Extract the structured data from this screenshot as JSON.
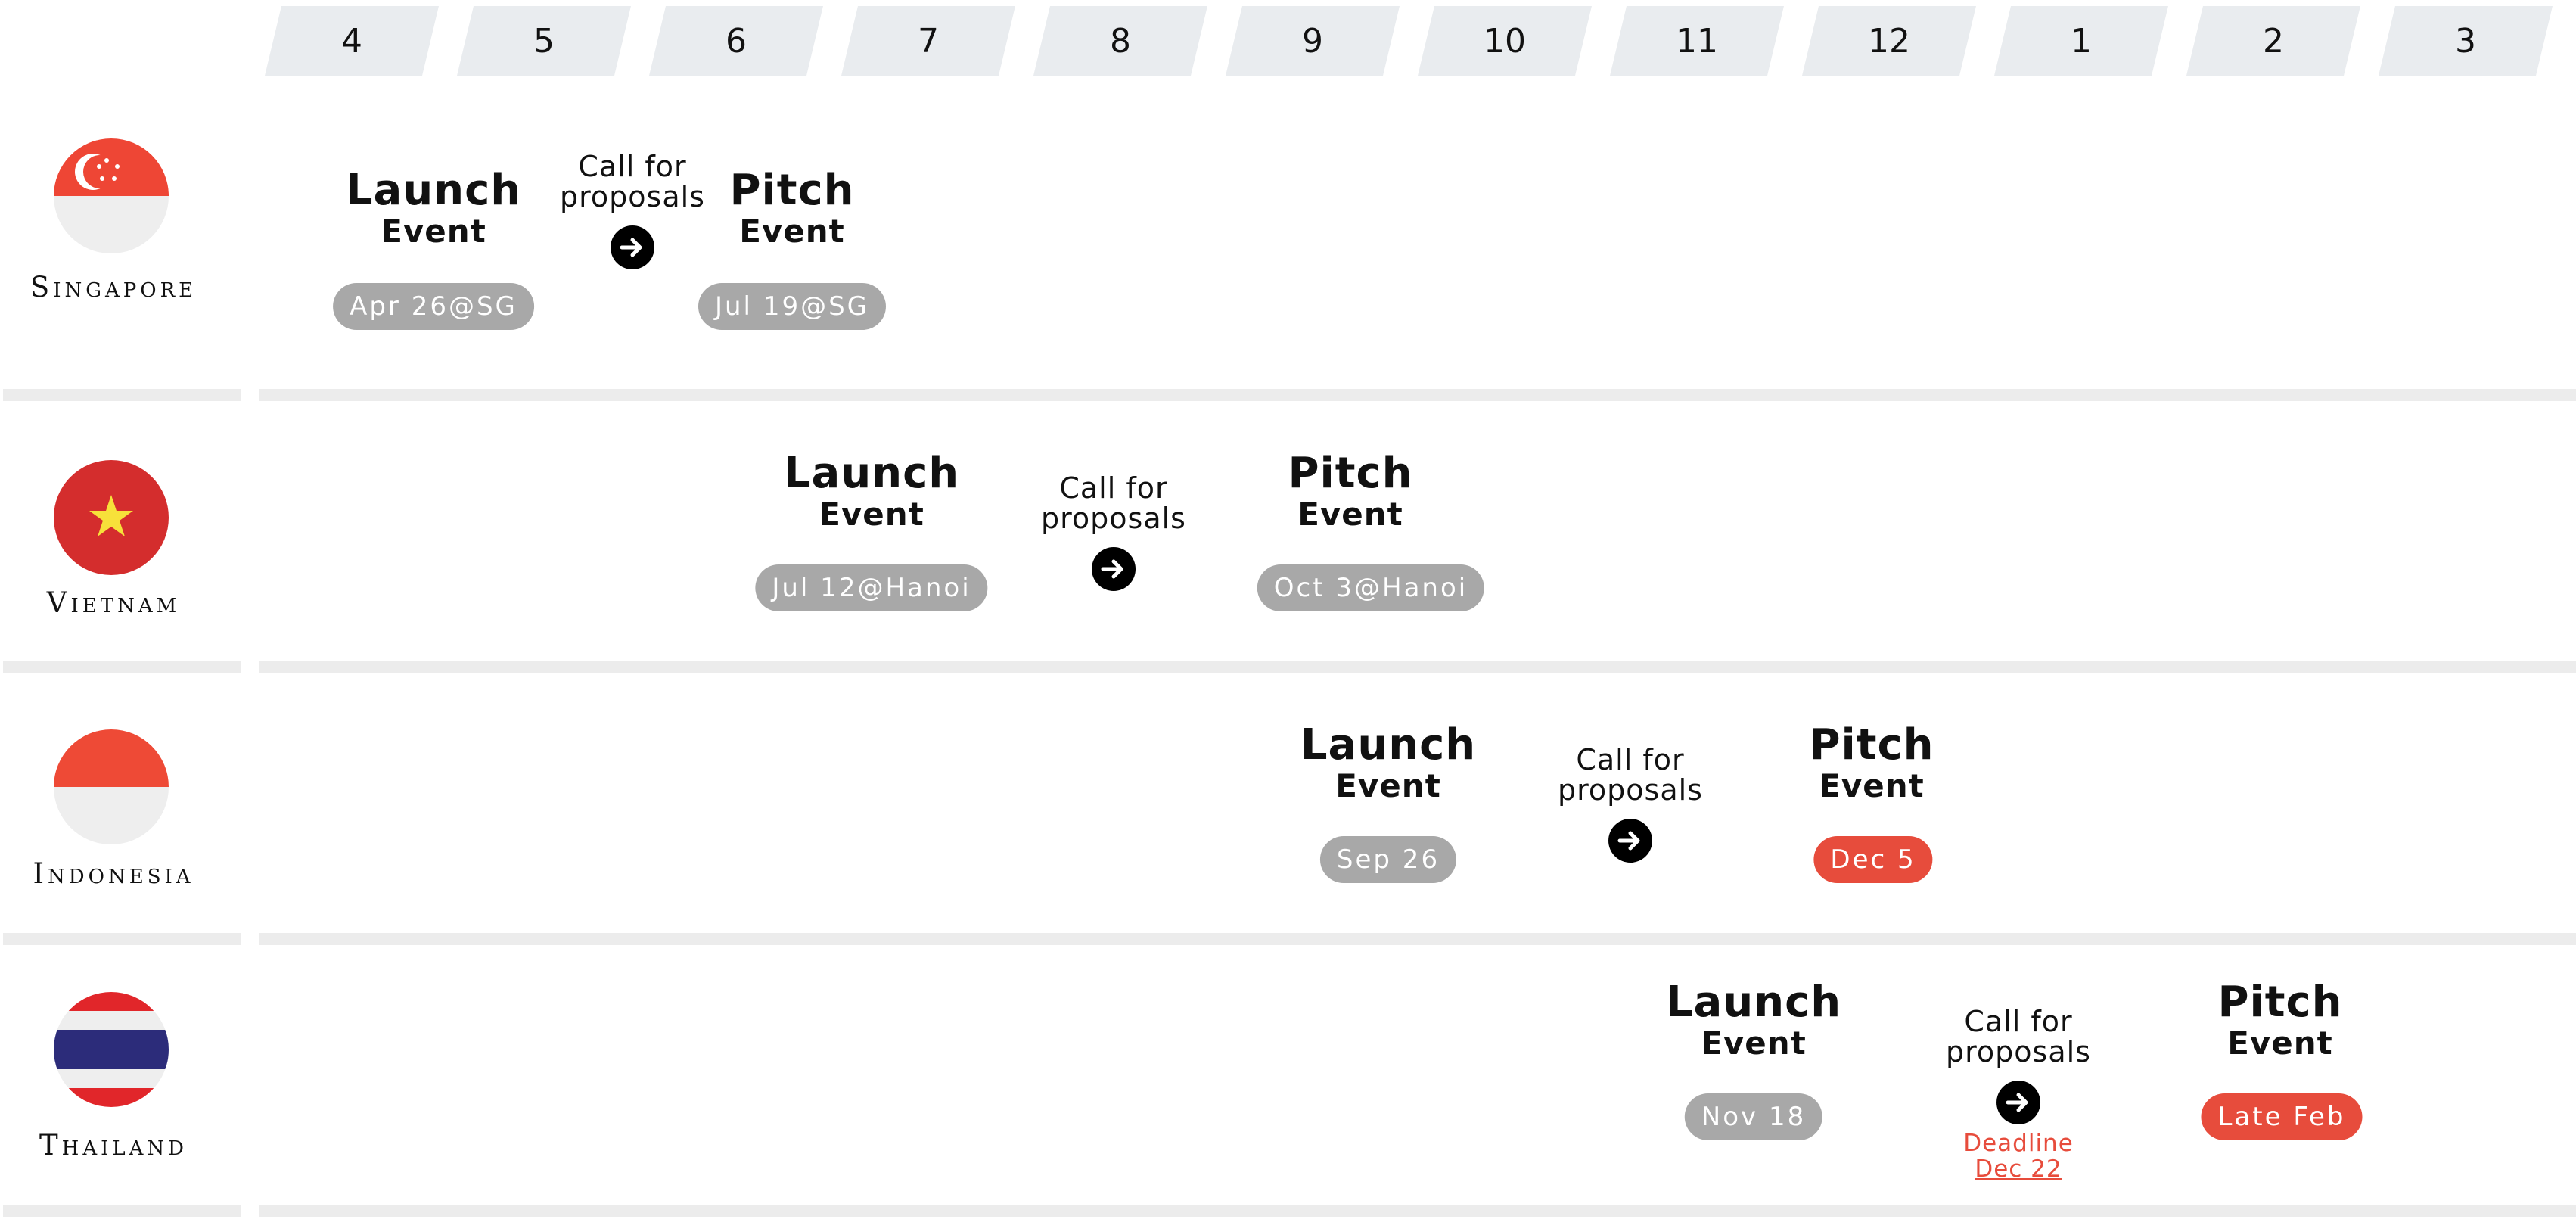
{
  "months": [
    "4",
    "5",
    "6",
    "7",
    "8",
    "9",
    "10",
    "11",
    "12",
    "1",
    "2",
    "3"
  ],
  "colors": {
    "badge_gray": "#a8a8a8",
    "badge_red": "#e74c3c",
    "header_bg": "#e9ecef"
  },
  "rows": [
    {
      "country": "Singapore",
      "flag_icon": "singapore-flag-icon",
      "launch": {
        "title": "Launch",
        "sub": "Event",
        "date": "Apr 26@SG"
      },
      "cfp": {
        "label_line1": "Call for",
        "label_line2": "proposals"
      },
      "pitch": {
        "title": "Pitch",
        "sub": "Event",
        "date": "Jul 19@SG"
      }
    },
    {
      "country": "Vietnam",
      "flag_icon": "vietnam-flag-icon",
      "launch": {
        "title": "Launch",
        "sub": "Event",
        "date": "Jul 12@Hanoi"
      },
      "cfp": {
        "label_line1": "Call for",
        "label_line2": "proposals"
      },
      "pitch": {
        "title": "Pitch",
        "sub": "Event",
        "date": "Oct 3@Hanoi"
      }
    },
    {
      "country": "Indonesia",
      "flag_icon": "indonesia-flag-icon",
      "launch": {
        "title": "Launch",
        "sub": "Event",
        "date": "Sep 26"
      },
      "cfp": {
        "label_line1": "Call for",
        "label_line2": "proposals"
      },
      "pitch": {
        "title": "Pitch",
        "sub": "Event",
        "date": "Dec 5"
      }
    },
    {
      "country": "Thailand",
      "flag_icon": "thailand-flag-icon",
      "launch": {
        "title": "Launch",
        "sub": "Event",
        "date": "Nov 18"
      },
      "cfp": {
        "label_line1": "Call for",
        "label_line2": "proposals",
        "deadline_label": "Deadline",
        "deadline_date": "Dec 22"
      },
      "pitch": {
        "title": "Pitch",
        "sub": "Event",
        "date": "Late Feb"
      }
    }
  ]
}
